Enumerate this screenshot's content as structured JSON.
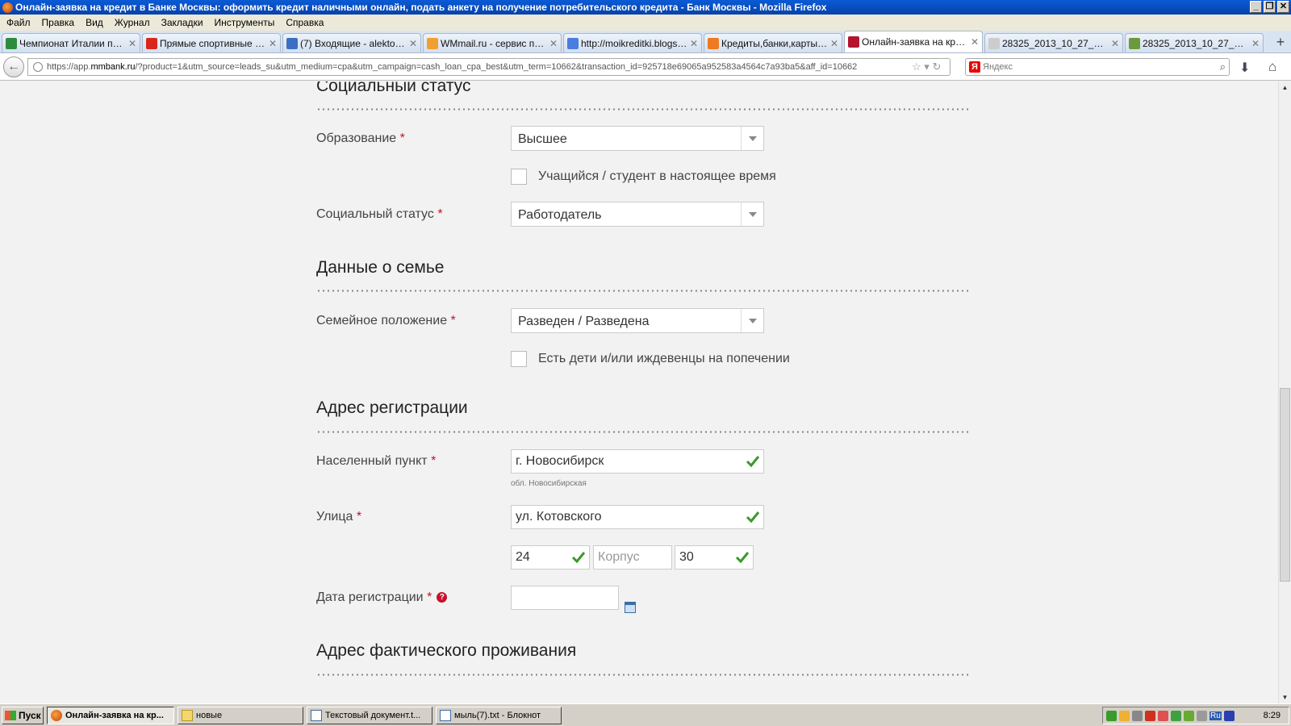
{
  "window": {
    "title": "Онлайн-заявка на кредит в Банке Москвы: оформить кредит наличными онлайн, подать анкету на получение потребительского кредита - Банк Москвы - Mozilla Firefox"
  },
  "menu": [
    "Файл",
    "Правка",
    "Вид",
    "Журнал",
    "Закладки",
    "Инструменты",
    "Справка"
  ],
  "tabs": [
    {
      "label": "Чемпионат Италии по ф...",
      "icon_color": "#2e8b3e"
    },
    {
      "label": "Прямые спортивные ви...",
      "icon_color": "#d9261c"
    },
    {
      "label": "(7) Входящие - alektoro...",
      "icon_color": "#3b6fc4"
    },
    {
      "label": "WMmail.ru - сервис почт...",
      "icon_color": "#f0a030"
    },
    {
      "label": "http://moikreditki.blogsp...",
      "icon_color": "#4a7de0"
    },
    {
      "label": "Кредиты,банки,карты:...",
      "icon_color": "#f07a20"
    },
    {
      "label": "Онлайн-заявка на кред...",
      "icon_color": "#b5122e",
      "active": true
    },
    {
      "label": "28325_2013_10_27_08-...",
      "icon_color": "#cccccc"
    },
    {
      "label": "28325_2013_10_27_08-...",
      "icon_color": "#6a9a3a"
    }
  ],
  "nav": {
    "url_prefix": "https://app.",
    "url_domain": "mmbank.ru",
    "url_rest": "/?product=1&utm_source=leads_su&utm_medium=cpa&utm_campaign=cash_loan_cpa_best&utm_term=10662&transaction_id=925718e69065a952583a4564c7a93ba5&aff_id=10662",
    "search_placeholder": "Яндекс"
  },
  "form": {
    "social_section_title": "Социальный статус",
    "education_label": "Образование",
    "education_value": "Высшее",
    "student_checkbox_label": "Учащийся / студент в настоящее время",
    "social_status_label": "Социальный статус",
    "social_status_value": "Работодатель",
    "family_section_title": "Данные о семье",
    "marital_label": "Семейное положение",
    "marital_value": "Разведен / Разведена",
    "children_checkbox_label": "Есть дети и/или иждевенцы на попечении",
    "reg_address_title": "Адрес регистрации",
    "city_label": "Населенный пункт",
    "city_value": "г. Новосибирск",
    "city_hint": "обл. Новосибирская",
    "street_label": "Улица",
    "street_value": "ул. Котовского",
    "house_value": "24",
    "building_placeholder": "Корпус",
    "apartment_value": "30",
    "reg_date_label": "Дата регистрации",
    "reg_date_value": "",
    "actual_address_title": "Адрес фактического проживания",
    "required_mark": "*",
    "help_mark": "?"
  },
  "taskbar": {
    "start_label": "Пуск",
    "buttons": [
      {
        "label": "Онлайн-заявка на кр...",
        "active": true
      },
      {
        "label": "новые"
      },
      {
        "label": "Текстовый документ.t..."
      },
      {
        "label": "мыль(7).txt - Блокнот"
      }
    ],
    "lang": "Ru",
    "clock": "8:29"
  },
  "colors": {
    "accent_red": "#c8102e",
    "check_green": "#3a9a2a"
  }
}
